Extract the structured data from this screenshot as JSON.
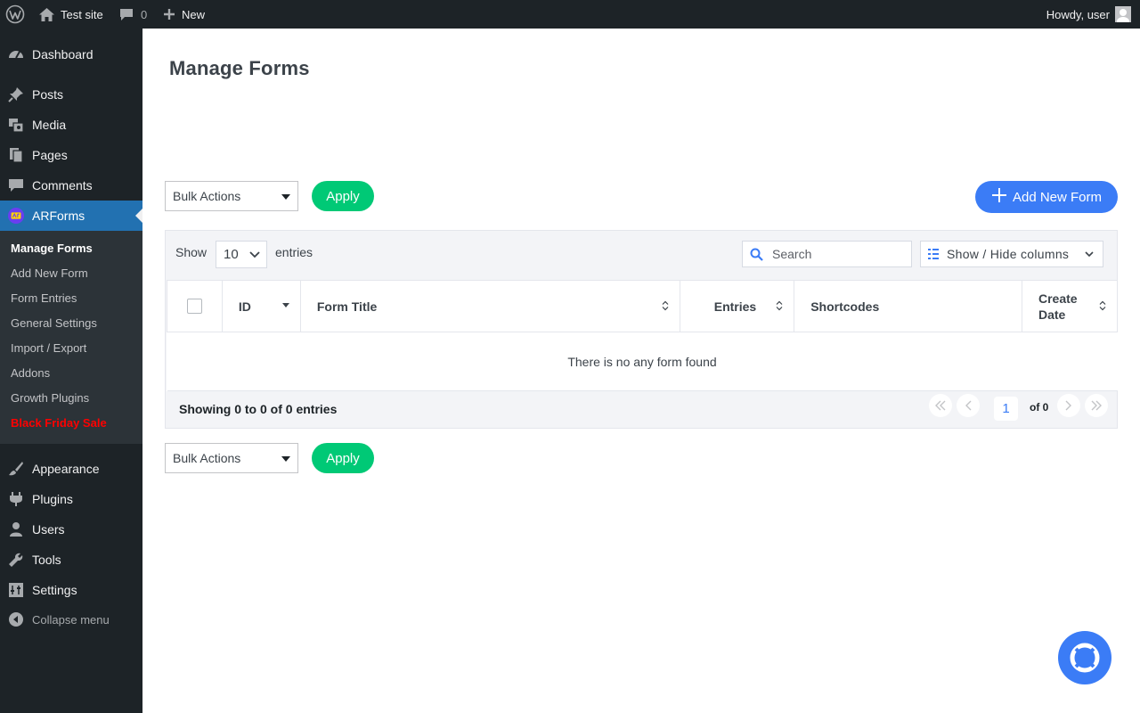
{
  "adminbar": {
    "site_name": "Test site",
    "comments_count": "0",
    "new_label": "New",
    "howdy": "Howdy, user"
  },
  "sidebar": {
    "items": [
      {
        "label": "Dashboard",
        "icon": "dashboard-icon"
      },
      {
        "label": "Posts",
        "icon": "pin-icon"
      },
      {
        "label": "Media",
        "icon": "media-icon"
      },
      {
        "label": "Pages",
        "icon": "pages-icon"
      },
      {
        "label": "Comments",
        "icon": "comment-icon"
      },
      {
        "label": "ARForms",
        "icon": "arforms-logo-icon"
      },
      {
        "label": "Appearance",
        "icon": "brush-icon"
      },
      {
        "label": "Plugins",
        "icon": "plugin-icon"
      },
      {
        "label": "Users",
        "icon": "user-icon"
      },
      {
        "label": "Tools",
        "icon": "wrench-icon"
      },
      {
        "label": "Settings",
        "icon": "settings-icon"
      }
    ],
    "collapse_label": "Collapse menu",
    "submenu": [
      {
        "label": "Manage Forms"
      },
      {
        "label": "Add New Form"
      },
      {
        "label": "Form Entries"
      },
      {
        "label": "General Settings"
      },
      {
        "label": "Import / Export"
      },
      {
        "label": "Addons"
      },
      {
        "label": "Growth Plugins"
      },
      {
        "label": "Black Friday Sale"
      }
    ]
  },
  "main": {
    "title": "Manage Forms",
    "bulk_actions_top": "Bulk Actions",
    "bulk_actions_bottom": "Bulk Actions",
    "apply_label": "Apply",
    "add_new_form_label": "Add New Form",
    "table_controls": {
      "show_label": "Show",
      "entries_value": "10",
      "entries_label": "entries",
      "search_placeholder": "Search",
      "columns_label": "Show / Hide columns"
    },
    "table": {
      "columns": [
        "ID",
        "Form Title",
        "Entries",
        "Shortcodes",
        "Create Date"
      ],
      "empty_message": "There is no any form found"
    },
    "footer": {
      "showing_text": "Showing 0 to 0 of 0 entries",
      "current_page": "1",
      "of_text": "of 0"
    }
  },
  "colors": {
    "admin_dark": "#1d2327",
    "wp_blue": "#2271b1",
    "apply_green": "#00c976",
    "primary_blue": "#3b7cf6",
    "sale_red": "#ff0000"
  }
}
